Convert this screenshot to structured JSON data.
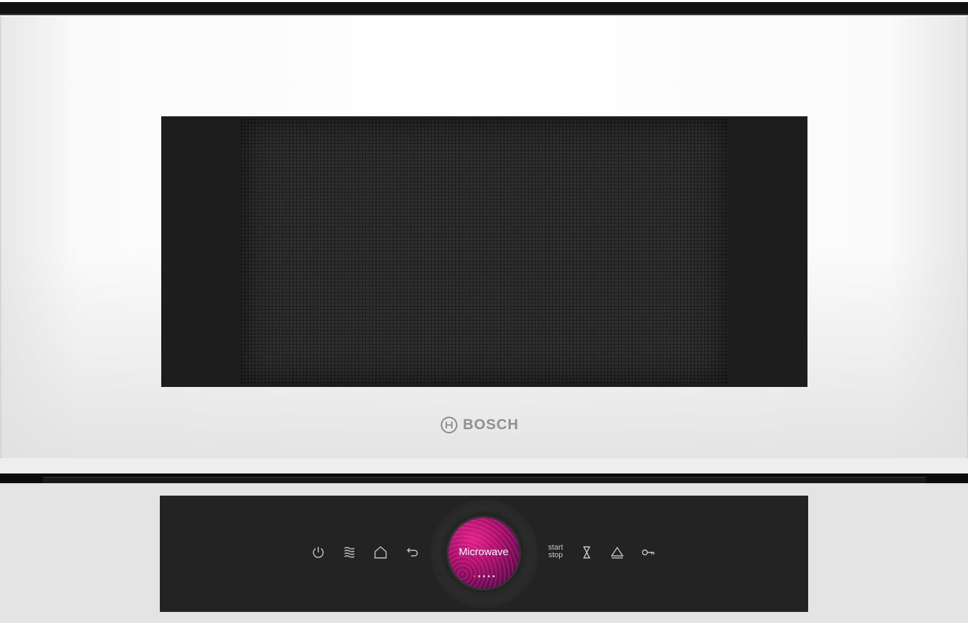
{
  "brand": {
    "name": "BOSCH"
  },
  "controls": {
    "power": {
      "icon": "power-icon"
    },
    "microwave_mode": {
      "icon": "microwave-waves-icon"
    },
    "home": {
      "icon": "home-icon"
    },
    "back": {
      "icon": "back-arrow-icon"
    },
    "start_stop": {
      "line1": "start",
      "line2": "stop"
    },
    "timer": {
      "icon": "hourglass-icon"
    },
    "info": {
      "icon": "triangle-icon"
    },
    "lock": {
      "icon": "key-icon"
    }
  },
  "dial": {
    "label": "Microwave",
    "page_count": 5,
    "active_page": 1
  },
  "colors": {
    "body": "#ffffff",
    "window": "#1d1d1d",
    "panel": "#232323",
    "dial_accent": "#b0106e",
    "indicator_active": "#ff3b3b"
  }
}
